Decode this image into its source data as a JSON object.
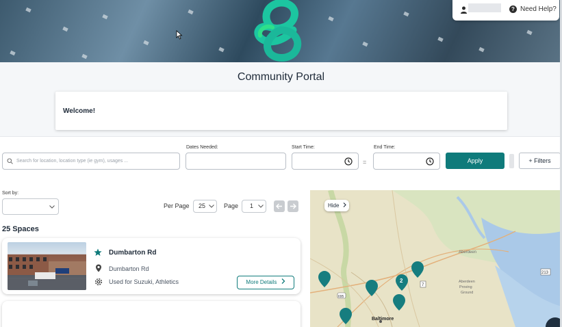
{
  "header": {
    "help_label": "Need Help?",
    "user_name": ""
  },
  "portal": {
    "title": "Community Portal",
    "welcome": "Welcome!"
  },
  "search": {
    "placeholder": "Search for location, location type (ie gym), usages ...",
    "dates_label": "Dates Needed:",
    "start_label": "Start Time:",
    "end_label": "End Time:",
    "separator": "=",
    "apply_label": "Apply",
    "filters_label": "+ Filters"
  },
  "results": {
    "sort_label": "Sort by:",
    "per_page_label": "Per Page",
    "per_page_value": "25",
    "page_label": "Page",
    "page_value": "1",
    "count_heading": "25 Spaces"
  },
  "spaces": [
    {
      "title": "Dumbarton Rd",
      "address": "Dumbarton Rd",
      "usage": "Used for Suzuki, Athletics",
      "details_label": "More Details"
    }
  ],
  "map": {
    "hide_label": "Hide",
    "labels": {
      "aberdeen": "Aberdeen",
      "aberdeen_proving_ground": [
        "Aberdeen",
        "Proving",
        "Ground"
      ],
      "baltimore": "Baltimore",
      "route_7": "7",
      "route_213": "213",
      "route_695": "695"
    },
    "cluster_count": "2"
  },
  "colors": {
    "accent": "#0f7b7b",
    "marker": "#167d7f",
    "logo_teal": "#1cc5a0",
    "logo_green": "#2ee08a"
  }
}
